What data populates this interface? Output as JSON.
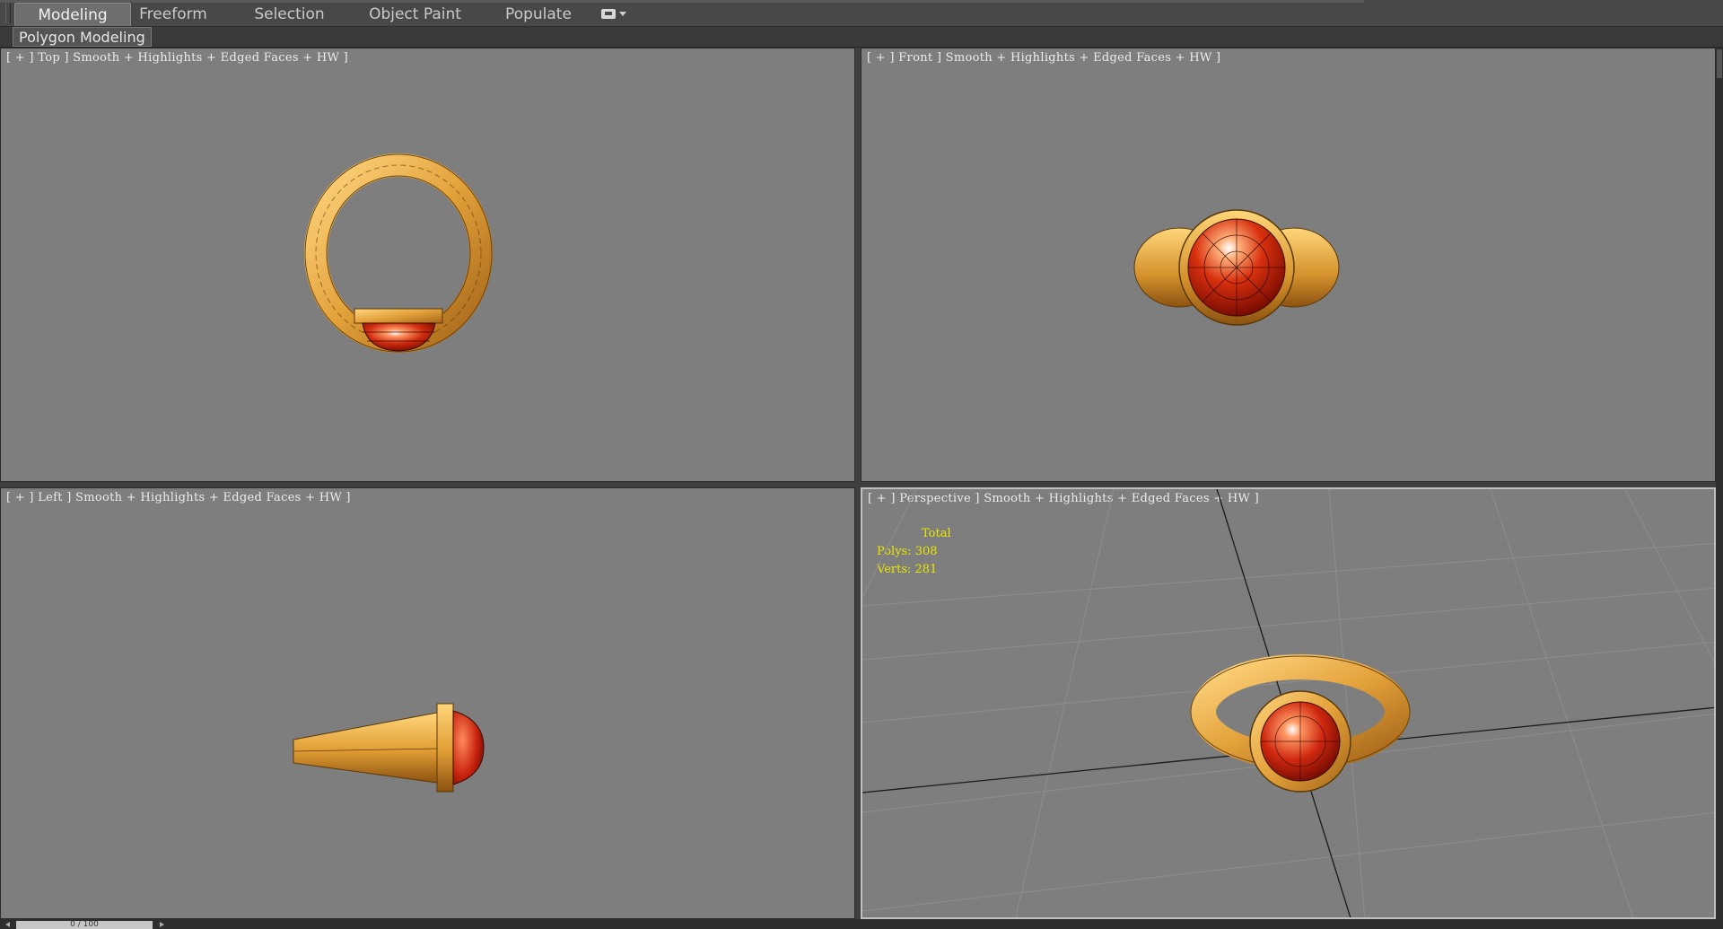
{
  "ribbon": {
    "tabs": [
      {
        "label": "Modeling",
        "active": true
      },
      {
        "label": "Freeform",
        "active": false
      },
      {
        "label": "Selection",
        "active": false
      },
      {
        "label": "Object Paint",
        "active": false
      },
      {
        "label": "Populate",
        "active": false
      }
    ],
    "subpanel": "Polygon Modeling"
  },
  "viewports": {
    "top": {
      "label": "[ + ] Top ] Smooth + Highlights + Edged Faces + HW ]"
    },
    "front": {
      "label": "[ + ] Front ] Smooth + Highlights + Edged Faces + HW ]"
    },
    "left": {
      "label": "[ + ] Left ] Smooth + Highlights + Edged Faces + HW ]"
    },
    "perspective": {
      "label": "[ + ] Perspective ] Smooth + Highlights + Edged Faces + HW ]"
    }
  },
  "stats": {
    "title": "Total",
    "polys": "Polys: 308",
    "verts": "Verts: 281"
  },
  "timeline": {
    "frame": "0 / 100"
  },
  "colors": {
    "viewport_bg": "#7e7e7e",
    "gold": "#e8a93c",
    "gold_dark": "#9a5b10",
    "gem": "#c8230e",
    "stats_text": "#e8e800"
  }
}
